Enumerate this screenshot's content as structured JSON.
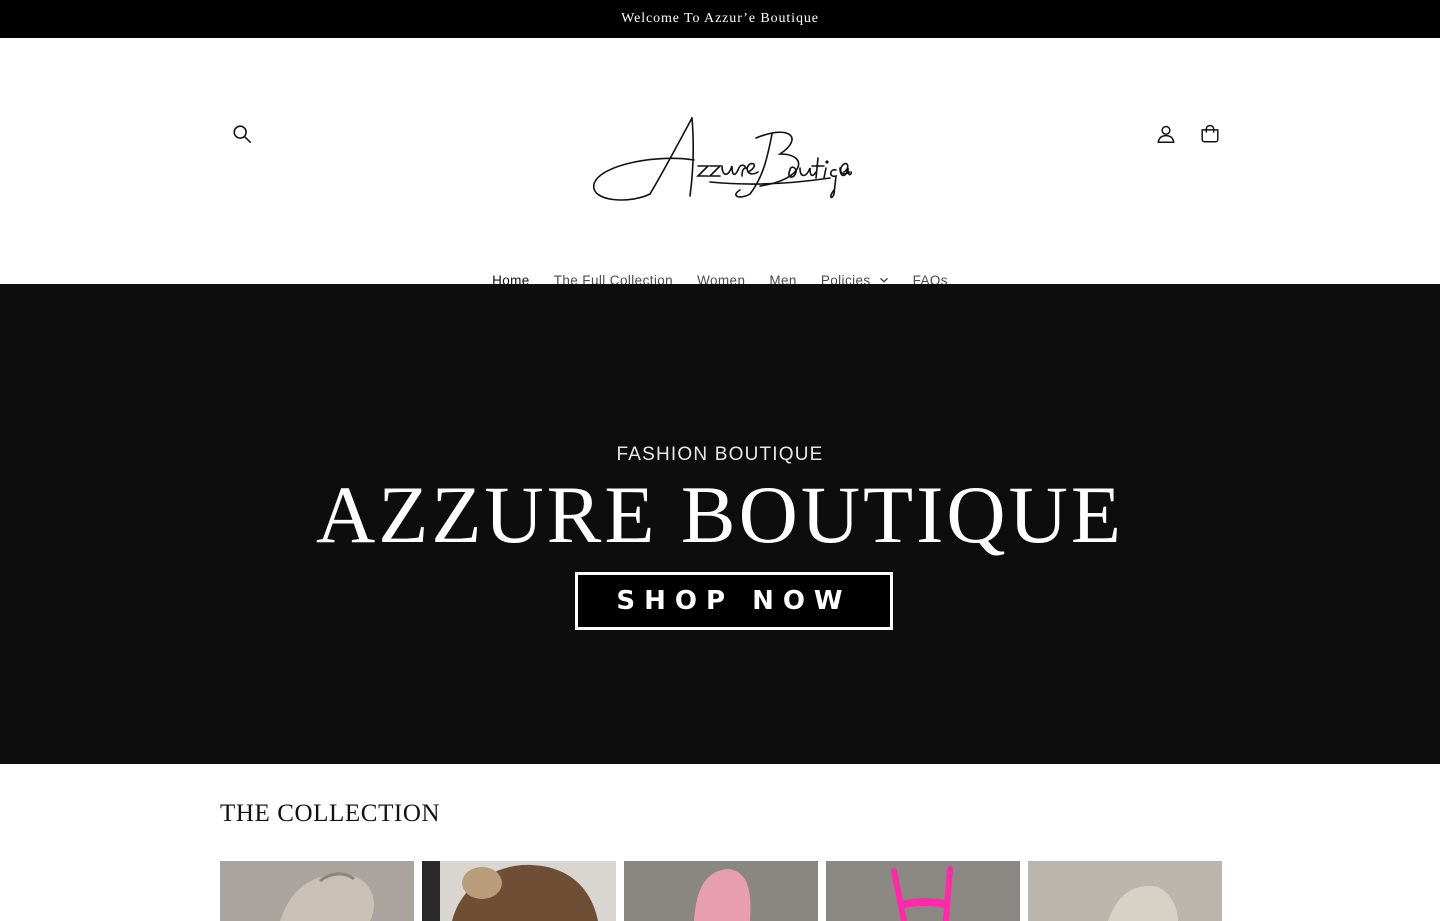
{
  "announcement": {
    "text": "Welcome To Azzur’e Boutique"
  },
  "header": {
    "logo_text": "Azzure Boutique",
    "icons": {
      "search": "search-icon",
      "account": "account-icon",
      "cart": "cart-icon"
    }
  },
  "nav": {
    "items": [
      {
        "label": "Home",
        "active": true
      },
      {
        "label": "The Full Collection"
      },
      {
        "label": "Women"
      },
      {
        "label": "Men"
      },
      {
        "label": "Policies",
        "has_dropdown": true
      },
      {
        "label": "FAQs"
      }
    ]
  },
  "hero": {
    "subtitle": "FASHION BOUTIQUE",
    "title": "AZZURE BOUTIQUE",
    "cta_label": "SHOP NOW",
    "background_color": "#0d0d0d"
  },
  "collection": {
    "title": "THE COLLECTION",
    "products": [
      {
        "name": "product-1",
        "color": "#b9b4ad"
      },
      {
        "name": "product-2",
        "color": "#7a5a3f"
      },
      {
        "name": "product-3",
        "color": "#d99aa6"
      },
      {
        "name": "product-4",
        "color": "#8f8c87"
      },
      {
        "name": "product-5",
        "color": "#c2bdb4"
      }
    ]
  }
}
